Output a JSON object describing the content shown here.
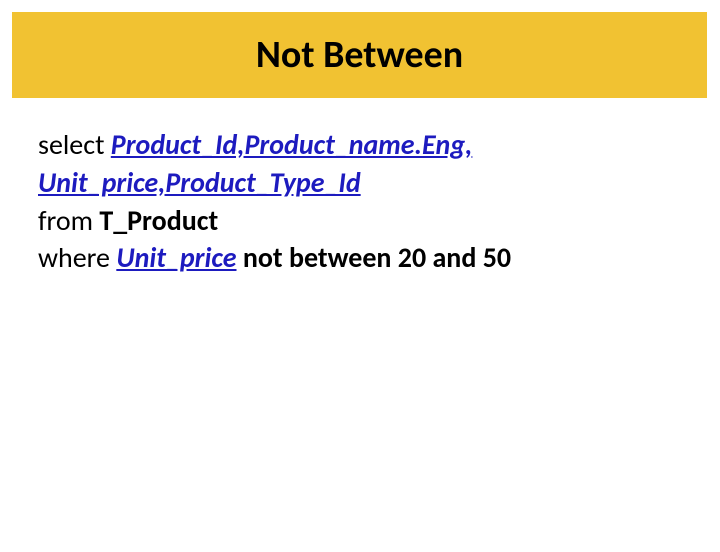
{
  "title": "Not Between",
  "sql": {
    "select_kw": "select ",
    "cols": "Product_Id,Product_name.Eng, Unit_price,Product_Type_Id",
    "from_kw": "from ",
    "table": "T_Product",
    "where_kw": "where ",
    "col_where": "Unit_price",
    "cond": " not between 20 and 50"
  }
}
